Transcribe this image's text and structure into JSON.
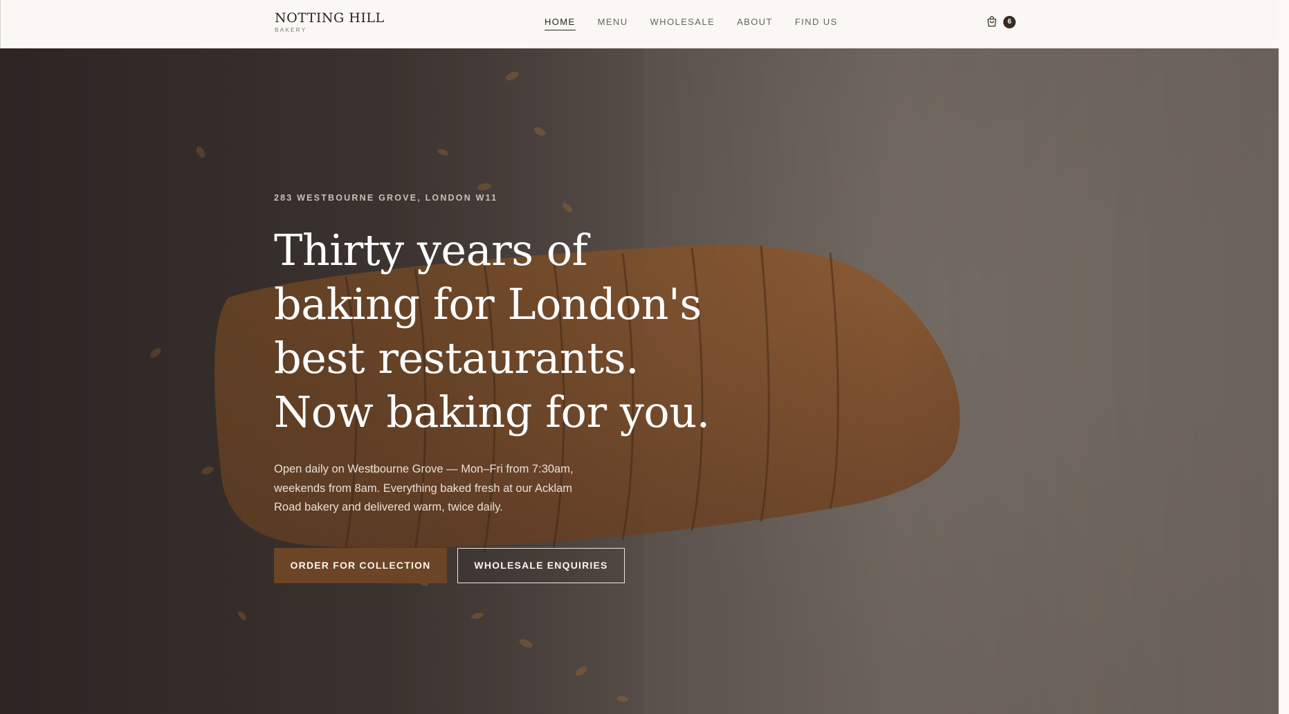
{
  "brand": {
    "name": "NOTTING HILL",
    "sub": "BAKERY"
  },
  "nav": {
    "items": [
      {
        "label": "HOME",
        "active": true
      },
      {
        "label": "MENU",
        "active": false
      },
      {
        "label": "WHOLESALE",
        "active": false
      },
      {
        "label": "ABOUT",
        "active": false
      },
      {
        "label": "FIND US",
        "active": false
      }
    ]
  },
  "cart": {
    "icon": "shopping-bag-icon",
    "count": "6"
  },
  "hero": {
    "eyebrow": "283 WESTBOURNE GROVE, LONDON W11",
    "headline": "Thirty years of baking for London's best restaurants. Now baking for you.",
    "lede": "Open daily on Westbourne Grove — Mon–Fri from 7:30am, weekends from 8am. Everything baked fresh at our Acklam Road bakery and delivered warm, twice daily.",
    "primary_cta": "ORDER FOR COLLECTION",
    "secondary_cta": "WHOLESALE ENQUIRIES"
  },
  "colors": {
    "header_bg": "#faf8f4",
    "text_dark": "#2b2420",
    "accent": "#6b4526",
    "badge": "#3a2a20"
  }
}
